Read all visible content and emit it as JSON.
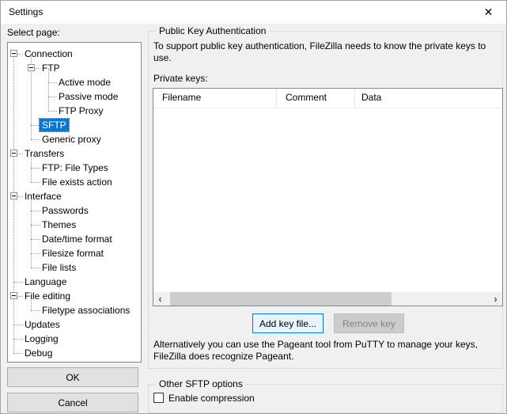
{
  "window": {
    "title": "Settings"
  },
  "icons": {
    "close": "✕",
    "collapse": "−",
    "scroll_left": "‹",
    "scroll_right": "›"
  },
  "colors": {
    "selection": "#0078d7",
    "focus_button_border": "#0078d7",
    "window_bg": "#f0f0f0",
    "titlebar_bg": "#ffffff",
    "disabled_button_bg": "#cccccc",
    "disabled_text": "#838383"
  },
  "sidebar": {
    "label": "Select page:",
    "tree_items": [
      {
        "label": "Connection",
        "level": 0,
        "expander": true,
        "selected": false
      },
      {
        "label": "FTP",
        "level": 1,
        "expander": true,
        "selected": false
      },
      {
        "label": "Active mode",
        "level": 2,
        "expander": false,
        "selected": false
      },
      {
        "label": "Passive mode",
        "level": 2,
        "expander": false,
        "selected": false
      },
      {
        "label": "FTP Proxy",
        "level": 2,
        "expander": false,
        "selected": false
      },
      {
        "label": "SFTP",
        "level": 1,
        "expander": false,
        "selected": true
      },
      {
        "label": "Generic proxy",
        "level": 1,
        "expander": false,
        "selected": false
      },
      {
        "label": "Transfers",
        "level": 0,
        "expander": true,
        "selected": false
      },
      {
        "label": "FTP: File Types",
        "level": 1,
        "expander": false,
        "selected": false
      },
      {
        "label": "File exists action",
        "level": 1,
        "expander": false,
        "selected": false
      },
      {
        "label": "Interface",
        "level": 0,
        "expander": true,
        "selected": false
      },
      {
        "label": "Passwords",
        "level": 1,
        "expander": false,
        "selected": false
      },
      {
        "label": "Themes",
        "level": 1,
        "expander": false,
        "selected": false
      },
      {
        "label": "Date/time format",
        "level": 1,
        "expander": false,
        "selected": false
      },
      {
        "label": "Filesize format",
        "level": 1,
        "expander": false,
        "selected": false
      },
      {
        "label": "File lists",
        "level": 1,
        "expander": false,
        "selected": false
      },
      {
        "label": "Language",
        "level": 0,
        "expander": false,
        "selected": false
      },
      {
        "label": "File editing",
        "level": 0,
        "expander": true,
        "selected": false
      },
      {
        "label": "Filetype associations",
        "level": 1,
        "expander": false,
        "selected": false
      },
      {
        "label": "Updates",
        "level": 0,
        "expander": false,
        "selected": false
      },
      {
        "label": "Logging",
        "level": 0,
        "expander": false,
        "selected": false
      },
      {
        "label": "Debug",
        "level": 0,
        "expander": false,
        "selected": false
      }
    ],
    "ok_label": "OK",
    "cancel_label": "Cancel"
  },
  "main": {
    "public_key_group": {
      "title": "Public Key Authentication",
      "description_lines": [
        "To support public key authentication, FileZilla needs to know the private keys to",
        "use."
      ],
      "private_keys_label": "Private keys:",
      "list_columns": [
        "Filename",
        "Comment",
        "Data"
      ],
      "list_rows": [],
      "add_key_button": "Add key file...",
      "remove_key_button": "Remove key",
      "pageant_lines": [
        "Alternatively you can use the Pageant tool from PuTTY to manage your keys,",
        "FileZilla does recognize Pageant."
      ]
    },
    "other_sftp_group": {
      "title": "Other SFTP options",
      "enable_compression_label": "Enable compression",
      "enable_compression_checked": false
    }
  }
}
